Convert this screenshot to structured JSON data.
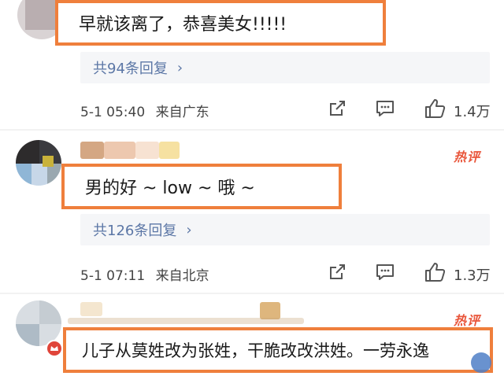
{
  "comments": [
    {
      "text": "早就该离了，恭喜美女!!!!!",
      "replies": "共94条回复",
      "time": "5-1 05:40",
      "source": "来自广东",
      "likes": "1.4万"
    },
    {
      "badge": "热评",
      "text": "男的好 ~ low ~ 哦 ~",
      "replies": "共126条回复",
      "time": "5-1 07:11",
      "source": "来自北京",
      "likes": "1.3万"
    },
    {
      "badge": "热评",
      "text": "儿子从莫姓改为张姓，干脆改改洪姓。一劳永逸"
    }
  ],
  "colors": {
    "highlight_border": "#ef7f3c",
    "reply_text": "#5c77a6",
    "hot_badge": "#e9563b"
  },
  "icons": [
    "chevron-right-icon",
    "share-icon",
    "comment-icon",
    "thumb-up-icon",
    "crown-badge-icon"
  ]
}
